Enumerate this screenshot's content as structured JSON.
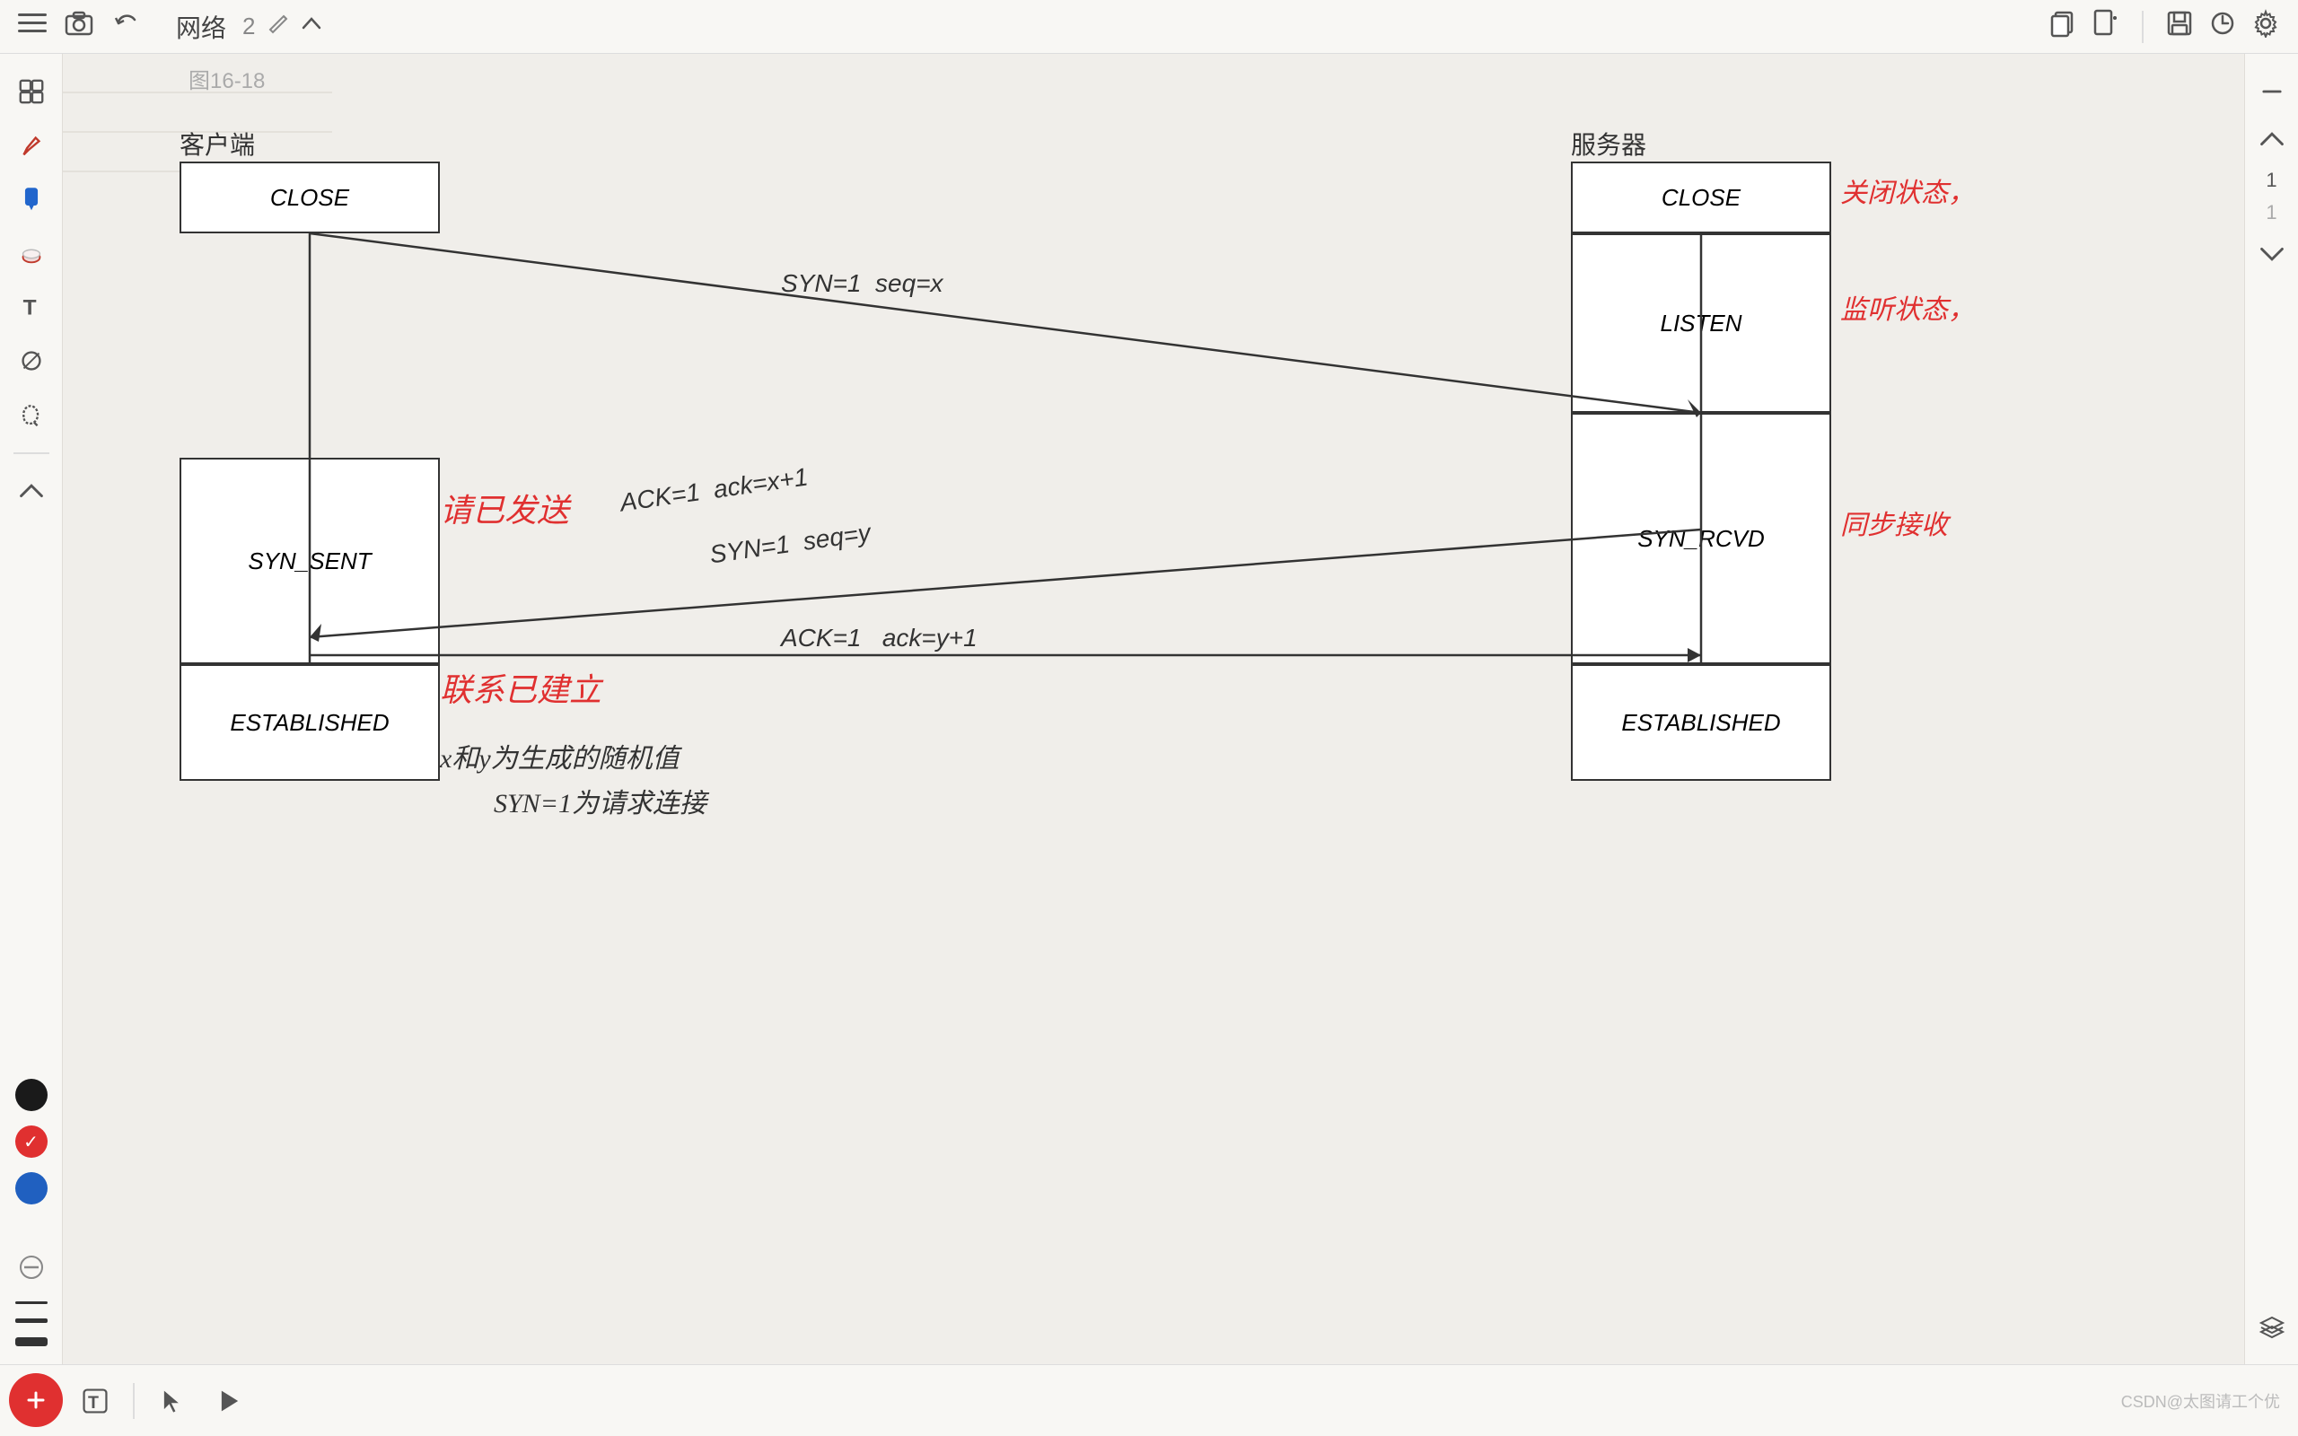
{
  "toolbar": {
    "title": "网络",
    "page_num": "2",
    "icons": {
      "menu": "☰",
      "camera": "📷",
      "undo": "↩",
      "chevron_up": "∧",
      "copy": "⧉",
      "new_page": "📄",
      "save": "💾",
      "history": "🕐",
      "settings": "⚙"
    }
  },
  "diagram": {
    "client_label": "客户端",
    "server_label": "服务器",
    "states": {
      "client_close": "CLOSE",
      "client_syn_sent": "SYN_SENT",
      "client_established": "ESTABLISHED",
      "server_close": "CLOSE",
      "server_listen": "LISTEN",
      "server_syn_rcvd": "SYN_RCVD",
      "server_established": "ESTABLISHED"
    },
    "annotations": {
      "syn_seq": "SYN=1  seq=x",
      "ack_syn": "ACK=1  ack=x+1",
      "syn_ack": "SYN=1  seq=y",
      "ack_final": "ACK=1   ack=y+1",
      "client_syn_sent_note": "请已发送",
      "client_established_note": "联系已建立",
      "server_close_note": "关闭状态，",
      "server_listen_note": "监听状态，",
      "server_syn_rcvd_note": "同步接收",
      "random_values": "x和y为生成的随机值",
      "syn_meaning": "SYN=1为请求连接"
    }
  },
  "bottom_toolbar": {
    "grid_icon": "⊞",
    "text_icon": "T",
    "separator": "|",
    "play_icon": "▶"
  },
  "watermark": "CSDN@太图请工个优"
}
